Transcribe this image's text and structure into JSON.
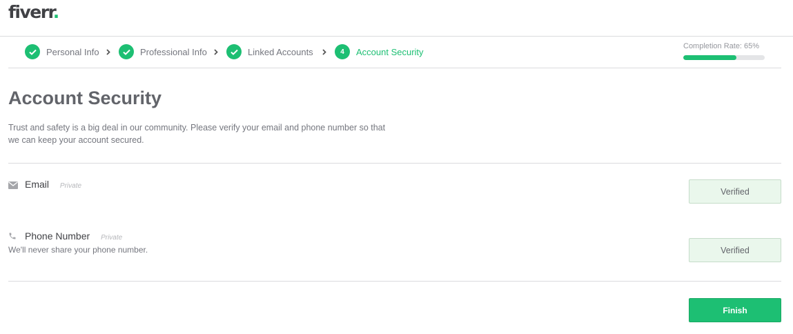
{
  "header": {
    "logo_text": "fiverr",
    "logo_dot": "."
  },
  "steps": [
    {
      "label": "Personal Info",
      "status": "complete",
      "icon": "check-icon"
    },
    {
      "label": "Professional Info",
      "status": "complete",
      "icon": "check-icon"
    },
    {
      "label": "Linked Accounts",
      "status": "complete",
      "icon": "check-icon"
    },
    {
      "label": "Account Security",
      "status": "active",
      "number": "4"
    }
  ],
  "completion": {
    "label": "Completion Rate: 65%",
    "value": 0.65
  },
  "page": {
    "title": "Account Security",
    "description": "Trust and safety is a big deal in our community. Please verify your email and phone number so that we can keep your account secured."
  },
  "email": {
    "label": "Email",
    "privacy": "Private",
    "icon": "envelope-icon",
    "button": "Verified"
  },
  "phone": {
    "label": "Phone Number",
    "privacy": "Private",
    "icon": "phone-icon",
    "note": "We'll never share your phone number.",
    "button": "Verified"
  },
  "actions": {
    "finish": "Finish"
  },
  "colors": {
    "brand": "#1dbf73",
    "text": "#62646a",
    "verified_bg": "#eaf7ec"
  }
}
